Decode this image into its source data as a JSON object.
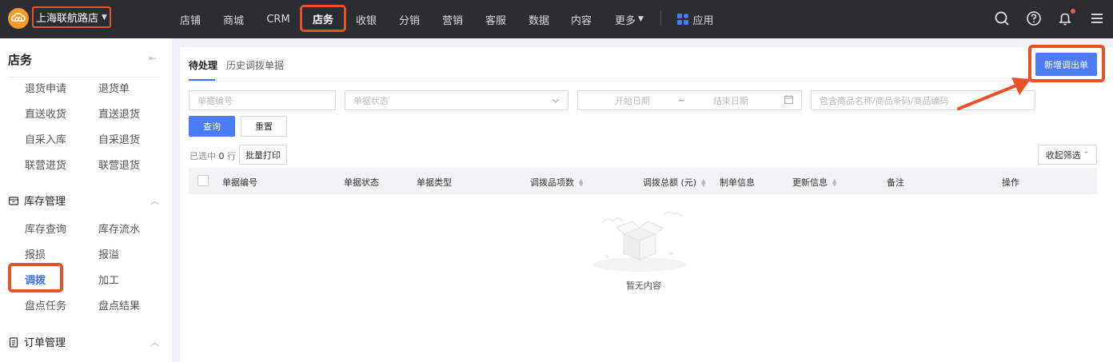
{
  "topbar": {
    "store_name": "上海联航路店",
    "nav": [
      {
        "label": "店铺"
      },
      {
        "label": "商城"
      },
      {
        "label": "CRM"
      },
      {
        "label": "店务"
      },
      {
        "label": "收银"
      },
      {
        "label": "分销"
      },
      {
        "label": "营销"
      },
      {
        "label": "客服"
      },
      {
        "label": "数据"
      },
      {
        "label": "内容"
      },
      {
        "label": "更多"
      }
    ],
    "apps_label": "应用",
    "icons": [
      "search-icon",
      "help-icon",
      "bell-icon",
      "menu-icon"
    ],
    "accent": "#e8512a"
  },
  "sidebar": {
    "title": "店务",
    "items_top": [
      "退货申请",
      "退货单",
      "直送收货",
      "直送退货",
      "自采入库",
      "自采退货",
      "联营进货",
      "联营退货"
    ],
    "group_inventory": "库存管理",
    "items_inventory": [
      "库存查询",
      "库存流水",
      "报损",
      "报溢",
      "调拨",
      "加工",
      "盘点任务",
      "盘点结果"
    ],
    "active_item": "调拨",
    "group_orders": "订单管理"
  },
  "main": {
    "tabs": [
      {
        "label": "待处理"
      },
      {
        "label": "历史调拨单据"
      }
    ],
    "new_button": "新增调出单",
    "filters": {
      "order_no_placeholder": "单据编号",
      "status_placeholder": "单据状态",
      "start_date_placeholder": "开始日期",
      "date_separator": "~",
      "end_date_placeholder": "结束日期",
      "product_placeholder": "包含商品名称/商品条码/商品编码"
    },
    "query_button": "查询",
    "reset_button": "重置",
    "selected_prefix": "已选中",
    "selected_count": "0",
    "selected_suffix": "行",
    "batch_print": "批量打印",
    "collapse_filter": "收起筛选",
    "columns": [
      "单据编号",
      "单据状态",
      "单据类型",
      "调拨品项数",
      "调拨总额 (元)",
      "制单信息",
      "更新信息",
      "备注",
      "操作"
    ],
    "empty_text": "暂无内容"
  },
  "colors": {
    "primary": "#4a7cf7",
    "topbar": "#2b2d33",
    "highlight": "#e8512a"
  }
}
